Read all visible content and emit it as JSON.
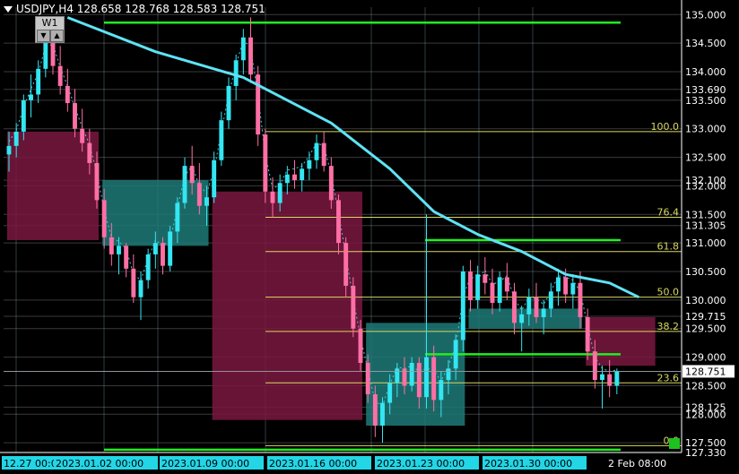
{
  "header": {
    "symbol": "USDJPY,H4",
    "ohlc": "128.658 128.768 128.583 128.751",
    "widget_label": "W1"
  },
  "colors": {
    "background": "#000000",
    "bull_candle": "#33e6f2",
    "bear_candle": "#ff6fa5",
    "ma_line": "#5fe3f5",
    "sr_lines": "#22ee22",
    "fib_lines": "#d8d860",
    "demand_zone": "#1f7a78",
    "supply_zone": "#7a1740",
    "price_tag": "#ffffff"
  },
  "price_axis": {
    "labels": [
      "135.000",
      "134.500",
      "134.000",
      "133.690",
      "133.500",
      "133.000",
      "132.500",
      "132.100",
      "132.000",
      "131.500",
      "131.305",
      "131.000",
      "130.500",
      "130.000",
      "129.715",
      "129.500",
      "129.000",
      "128.751",
      "128.500",
      "128.125",
      "128.000",
      "127.500",
      "127.330"
    ],
    "current_price": "128.751"
  },
  "time_axis": {
    "labels": [
      "12.27 00:00",
      "2023.01.02 00:00",
      "2023.01.09 00:00",
      "2023.01.16 00:00",
      "2023.01.23 00:00",
      "2023.01.30 00:00",
      "2 Feb 08:00"
    ]
  },
  "fib_levels": [
    "100.0",
    "76.4",
    "61.8",
    "50.0",
    "38.2",
    "23.6",
    "0.0"
  ],
  "chart_data": {
    "type": "candlestick",
    "title": "USDJPY,H4",
    "ylim": [
      127.33,
      135.13
    ],
    "grid": true,
    "current_price": 128.751,
    "candles": [
      {
        "o": 132.55,
        "h": 132.95,
        "l": 132.25,
        "c": 132.7
      },
      {
        "o": 132.7,
        "h": 133.1,
        "l": 132.5,
        "c": 132.95
      },
      {
        "o": 132.95,
        "h": 133.6,
        "l": 132.8,
        "c": 133.5
      },
      {
        "o": 133.5,
        "h": 133.95,
        "l": 133.2,
        "c": 133.6
      },
      {
        "o": 133.6,
        "h": 134.2,
        "l": 133.45,
        "c": 134.05
      },
      {
        "o": 134.05,
        "h": 134.7,
        "l": 133.9,
        "c": 134.55
      },
      {
        "o": 134.55,
        "h": 134.9,
        "l": 133.95,
        "c": 134.1
      },
      {
        "o": 134.1,
        "h": 134.45,
        "l": 133.6,
        "c": 133.75
      },
      {
        "o": 133.75,
        "h": 134.05,
        "l": 133.3,
        "c": 133.45
      },
      {
        "o": 133.45,
        "h": 133.7,
        "l": 132.85,
        "c": 133.0
      },
      {
        "o": 133.0,
        "h": 133.35,
        "l": 132.6,
        "c": 132.75
      },
      {
        "o": 132.75,
        "h": 133.0,
        "l": 132.2,
        "c": 132.4
      },
      {
        "o": 132.4,
        "h": 132.6,
        "l": 131.6,
        "c": 131.75
      },
      {
        "o": 131.75,
        "h": 131.95,
        "l": 130.9,
        "c": 131.1
      },
      {
        "o": 131.1,
        "h": 131.35,
        "l": 130.6,
        "c": 130.8
      },
      {
        "o": 130.8,
        "h": 131.1,
        "l": 130.45,
        "c": 130.95
      },
      {
        "o": 130.95,
        "h": 131.0,
        "l": 130.4,
        "c": 130.55
      },
      {
        "o": 130.55,
        "h": 130.8,
        "l": 129.95,
        "c": 130.05
      },
      {
        "o": 130.05,
        "h": 130.5,
        "l": 129.65,
        "c": 130.35
      },
      {
        "o": 130.35,
        "h": 130.9,
        "l": 130.2,
        "c": 130.8
      },
      {
        "o": 130.8,
        "h": 131.2,
        "l": 130.55,
        "c": 131.0
      },
      {
        "o": 131.0,
        "h": 131.1,
        "l": 130.45,
        "c": 130.6
      },
      {
        "o": 130.6,
        "h": 131.3,
        "l": 130.5,
        "c": 131.2
      },
      {
        "o": 131.2,
        "h": 131.8,
        "l": 131.0,
        "c": 131.7
      },
      {
        "o": 131.7,
        "h": 132.5,
        "l": 131.6,
        "c": 132.35
      },
      {
        "o": 132.35,
        "h": 132.7,
        "l": 131.85,
        "c": 132.05
      },
      {
        "o": 132.05,
        "h": 132.4,
        "l": 131.5,
        "c": 131.65
      },
      {
        "o": 131.65,
        "h": 132.0,
        "l": 131.3,
        "c": 131.8
      },
      {
        "o": 131.8,
        "h": 132.6,
        "l": 131.7,
        "c": 132.45
      },
      {
        "o": 132.45,
        "h": 133.3,
        "l": 132.35,
        "c": 133.15
      },
      {
        "o": 133.15,
        "h": 133.9,
        "l": 133.0,
        "c": 133.75
      },
      {
        "o": 133.75,
        "h": 134.3,
        "l": 133.5,
        "c": 134.2
      },
      {
        "o": 134.2,
        "h": 134.75,
        "l": 133.95,
        "c": 134.6
      },
      {
        "o": 134.6,
        "h": 134.95,
        "l": 133.8,
        "c": 133.95
      },
      {
        "o": 133.95,
        "h": 134.1,
        "l": 132.7,
        "c": 132.9
      },
      {
        "o": 132.9,
        "h": 133.0,
        "l": 131.7,
        "c": 131.9
      },
      {
        "o": 131.9,
        "h": 132.15,
        "l": 131.45,
        "c": 131.7
      },
      {
        "o": 131.7,
        "h": 132.2,
        "l": 131.55,
        "c": 132.05
      },
      {
        "o": 132.05,
        "h": 132.35,
        "l": 131.85,
        "c": 132.2
      },
      {
        "o": 132.2,
        "h": 132.45,
        "l": 131.95,
        "c": 132.1
      },
      {
        "o": 132.1,
        "h": 132.4,
        "l": 131.9,
        "c": 132.3
      },
      {
        "o": 132.3,
        "h": 132.6,
        "l": 132.1,
        "c": 132.45
      },
      {
        "o": 132.45,
        "h": 132.9,
        "l": 132.3,
        "c": 132.75
      },
      {
        "o": 132.75,
        "h": 132.95,
        "l": 132.25,
        "c": 132.35
      },
      {
        "o": 132.35,
        "h": 132.5,
        "l": 131.6,
        "c": 131.75
      },
      {
        "o": 131.75,
        "h": 131.85,
        "l": 130.8,
        "c": 131.0
      },
      {
        "o": 131.0,
        "h": 131.1,
        "l": 130.05,
        "c": 130.25
      },
      {
        "o": 130.25,
        "h": 130.4,
        "l": 129.35,
        "c": 129.5
      },
      {
        "o": 129.5,
        "h": 129.65,
        "l": 128.75,
        "c": 128.9
      },
      {
        "o": 128.9,
        "h": 129.05,
        "l": 128.2,
        "c": 128.35
      },
      {
        "o": 128.35,
        "h": 128.5,
        "l": 127.6,
        "c": 127.8
      },
      {
        "o": 127.8,
        "h": 128.3,
        "l": 127.5,
        "c": 128.2
      },
      {
        "o": 128.2,
        "h": 128.7,
        "l": 128.0,
        "c": 128.55
      },
      {
        "o": 128.55,
        "h": 128.9,
        "l": 128.3,
        "c": 128.8
      },
      {
        "o": 128.8,
        "h": 129.0,
        "l": 128.35,
        "c": 128.5
      },
      {
        "o": 128.5,
        "h": 129.0,
        "l": 128.4,
        "c": 128.9
      },
      {
        "o": 128.9,
        "h": 129.0,
        "l": 128.1,
        "c": 128.3
      },
      {
        "o": 128.3,
        "h": 131.5,
        "l": 128.1,
        "c": 129.0
      },
      {
        "o": 129.0,
        "h": 129.2,
        "l": 128.05,
        "c": 128.25
      },
      {
        "o": 128.25,
        "h": 128.75,
        "l": 127.95,
        "c": 128.6
      },
      {
        "o": 128.6,
        "h": 128.95,
        "l": 128.35,
        "c": 128.8
      },
      {
        "o": 128.8,
        "h": 129.4,
        "l": 128.6,
        "c": 129.3
      },
      {
        "o": 129.3,
        "h": 130.6,
        "l": 129.1,
        "c": 130.5
      },
      {
        "o": 130.5,
        "h": 130.7,
        "l": 129.8,
        "c": 130.0
      },
      {
        "o": 130.0,
        "h": 130.6,
        "l": 129.85,
        "c": 130.45
      },
      {
        "o": 130.45,
        "h": 130.75,
        "l": 130.1,
        "c": 130.3
      },
      {
        "o": 130.3,
        "h": 130.55,
        "l": 129.75,
        "c": 129.95
      },
      {
        "o": 129.95,
        "h": 130.5,
        "l": 129.8,
        "c": 130.4
      },
      {
        "o": 130.4,
        "h": 130.65,
        "l": 130.0,
        "c": 130.15
      },
      {
        "o": 130.15,
        "h": 130.3,
        "l": 129.4,
        "c": 129.6
      },
      {
        "o": 129.6,
        "h": 129.9,
        "l": 129.1,
        "c": 129.75
      },
      {
        "o": 129.75,
        "h": 130.2,
        "l": 129.55,
        "c": 130.05
      },
      {
        "o": 130.05,
        "h": 130.3,
        "l": 129.6,
        "c": 129.7
      },
      {
        "o": 129.7,
        "h": 130.0,
        "l": 129.4,
        "c": 129.85
      },
      {
        "o": 129.85,
        "h": 130.3,
        "l": 129.7,
        "c": 130.15
      },
      {
        "o": 130.15,
        "h": 130.55,
        "l": 129.9,
        "c": 130.4
      },
      {
        "o": 130.4,
        "h": 130.55,
        "l": 129.95,
        "c": 130.1
      },
      {
        "o": 130.1,
        "h": 130.45,
        "l": 129.85,
        "c": 130.3
      },
      {
        "o": 130.3,
        "h": 130.5,
        "l": 129.5,
        "c": 129.7
      },
      {
        "o": 129.7,
        "h": 129.85,
        "l": 128.95,
        "c": 129.1
      },
      {
        "o": 129.1,
        "h": 129.3,
        "l": 128.45,
        "c": 128.6
      },
      {
        "o": 128.6,
        "h": 128.85,
        "l": 128.1,
        "c": 128.7
      },
      {
        "o": 128.7,
        "h": 128.95,
        "l": 128.3,
        "c": 128.5
      },
      {
        "o": 128.5,
        "h": 128.8,
        "l": 128.35,
        "c": 128.75
      }
    ],
    "moving_average": [
      {
        "i": 8,
        "v": 134.95
      },
      {
        "i": 20,
        "v": 134.35
      },
      {
        "i": 32,
        "v": 133.9
      },
      {
        "i": 44,
        "v": 133.1
      },
      {
        "i": 52,
        "v": 132.3
      },
      {
        "i": 58,
        "v": 131.55
      },
      {
        "i": 64,
        "v": 131.15
      },
      {
        "i": 70,
        "v": 130.85
      },
      {
        "i": 76,
        "v": 130.45
      },
      {
        "i": 82,
        "v": 130.3
      },
      {
        "i": 86,
        "v": 130.05
      }
    ],
    "horizontal_lines": [
      134.86,
      131.05,
      129.05,
      127.38
    ],
    "fib_prices": {
      "100.0": 132.95,
      "76.4": 131.45,
      "61.8": 130.85,
      "50.0": 130.05,
      "38.2": 129.45,
      "23.6": 128.55,
      "0.0": 127.45
    },
    "zones": [
      {
        "kind": "supply",
        "i0": 0,
        "i1": 12,
        "top": 132.95,
        "bottom": 131.05
      },
      {
        "kind": "demand",
        "i0": 13,
        "i1": 27,
        "top": 132.1,
        "bottom": 130.95
      },
      {
        "kind": "supply",
        "i0": 28,
        "i1": 48,
        "top": 131.9,
        "bottom": 127.9
      },
      {
        "kind": "demand",
        "i0": 49,
        "i1": 62,
        "top": 129.6,
        "bottom": 127.8
      },
      {
        "kind": "demand",
        "i0": 63,
        "i1": 78,
        "top": 129.85,
        "bottom": 129.5
      },
      {
        "kind": "supply",
        "i0": 79,
        "i1": 88,
        "top": 129.7,
        "bottom": 128.85
      }
    ]
  }
}
